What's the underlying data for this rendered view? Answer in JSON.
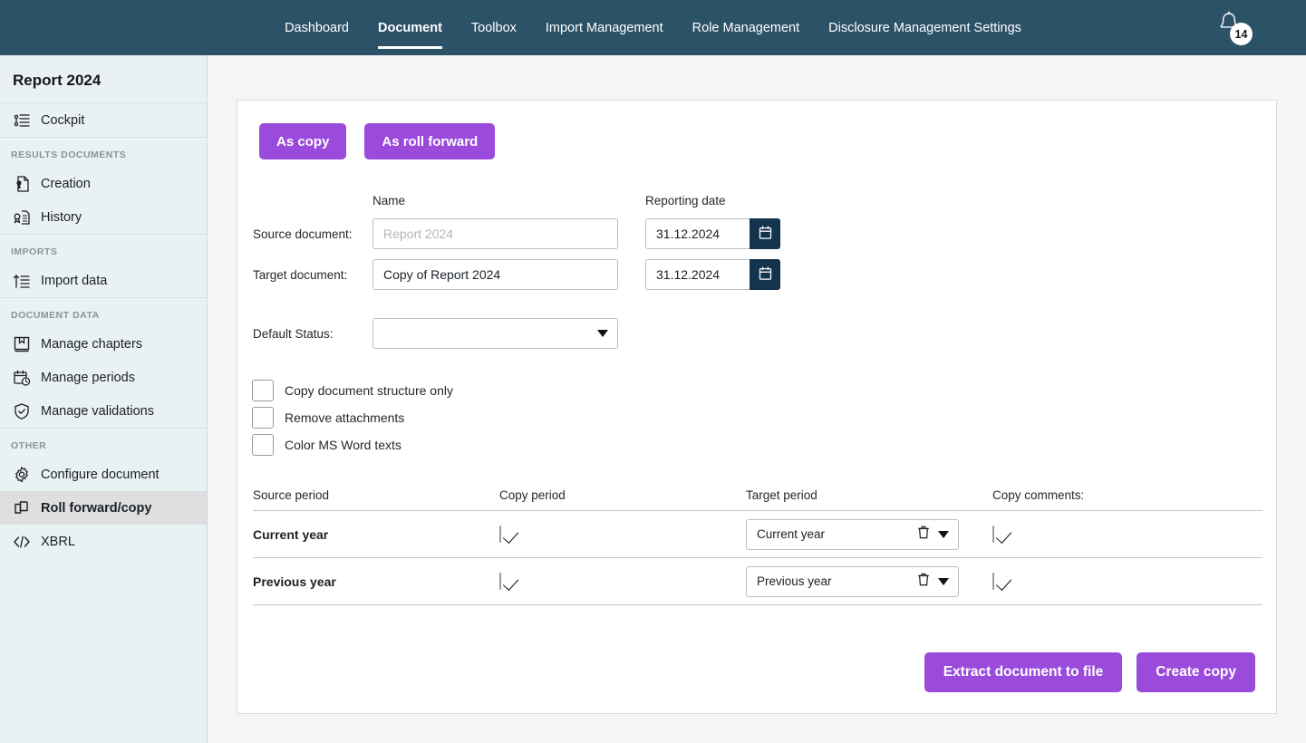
{
  "topnav": {
    "items": [
      {
        "label": "Dashboard",
        "active": false
      },
      {
        "label": "Document",
        "active": true
      },
      {
        "label": "Toolbox",
        "active": false
      },
      {
        "label": "Import Management",
        "active": false
      },
      {
        "label": "Role Management",
        "active": false
      },
      {
        "label": "Disclosure Management Settings",
        "active": false
      }
    ],
    "notification_count": "14",
    "background_color": "#2c5268"
  },
  "sidebar": {
    "title": "Report 2024",
    "groups": [
      {
        "header": "",
        "items": [
          {
            "label": "Cockpit",
            "icon": "list-tree-icon",
            "selected": false
          }
        ]
      },
      {
        "header": "RESULTS DOCUMENTS",
        "items": [
          {
            "label": "Creation",
            "icon": "document-seal-icon",
            "selected": false
          },
          {
            "label": "History",
            "icon": "seal-history-icon",
            "selected": false
          }
        ]
      },
      {
        "header": "IMPORTS",
        "items": [
          {
            "label": "Import data",
            "icon": "upload-list-icon",
            "selected": false
          }
        ]
      },
      {
        "header": "DOCUMENT DATA",
        "items": [
          {
            "label": "Manage chapters",
            "icon": "book-bookmark-icon",
            "selected": false
          },
          {
            "label": "Manage periods",
            "icon": "calendar-clock-icon",
            "selected": false
          },
          {
            "label": "Manage validations",
            "icon": "shield-check-icon",
            "selected": false
          }
        ]
      },
      {
        "header": "OTHER",
        "items": [
          {
            "label": "Configure document",
            "icon": "gear-icon",
            "selected": false
          },
          {
            "label": "Roll forward/copy",
            "icon": "copy-pages-icon",
            "selected": true
          },
          {
            "label": "XBRL",
            "icon": "code-brackets-icon",
            "selected": false
          }
        ]
      }
    ]
  },
  "main": {
    "mode_buttons": [
      {
        "label": "As copy"
      },
      {
        "label": "As roll forward"
      }
    ],
    "columns": {
      "name": "Name",
      "reporting_date": "Reporting date"
    },
    "source_document": {
      "label": "Source document:",
      "name_value": "",
      "name_placeholder": "Report 2024",
      "date_value": "31.12.2024"
    },
    "target_document": {
      "label": "Target document:",
      "name_value": "Copy of Report 2024",
      "name_placeholder": "",
      "date_value": "31.12.2024"
    },
    "default_status": {
      "label": "Default Status:",
      "value": ""
    },
    "options": [
      {
        "label": "Copy document structure only",
        "checked": false
      },
      {
        "label": "Remove attachments",
        "checked": false
      },
      {
        "label": "Color MS Word texts",
        "checked": false
      }
    ],
    "periods_table": {
      "headers": [
        "Source period",
        "Copy period",
        "Target period",
        "Copy comments:"
      ],
      "rows": [
        {
          "source_period": "Current year",
          "copy_period": true,
          "target_period": "Current year",
          "copy_comments": true
        },
        {
          "source_period": "Previous year",
          "copy_period": true,
          "target_period": "Previous year",
          "copy_comments": true
        }
      ]
    },
    "footer_buttons": [
      {
        "label": "Extract document to file"
      },
      {
        "label": "Create copy"
      }
    ]
  },
  "colors": {
    "accent_purple": "#9b4bdb",
    "header_navy": "#2c5268",
    "date_button_navy": "#14334d",
    "sidebar_bg": "#e9f1f5",
    "selected_item_bg": "#dfdfdf"
  }
}
